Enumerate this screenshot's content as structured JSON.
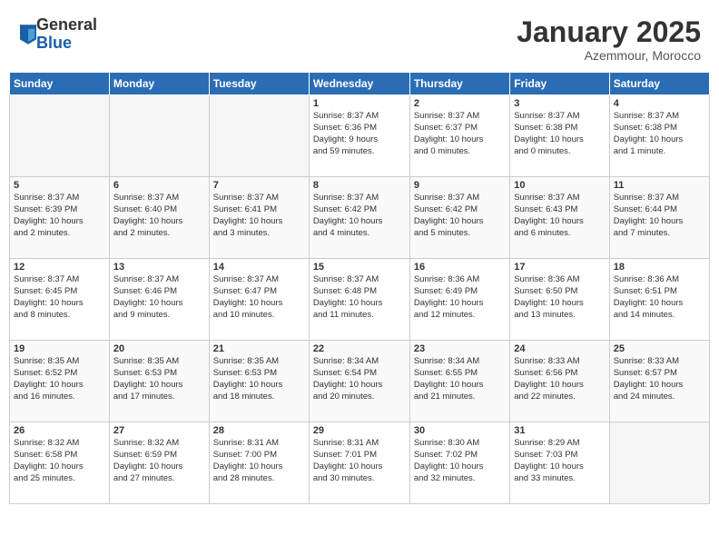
{
  "header": {
    "logo_general": "General",
    "logo_blue": "Blue",
    "month_title": "January 2025",
    "location": "Azemmour, Morocco"
  },
  "weekdays": [
    "Sunday",
    "Monday",
    "Tuesday",
    "Wednesday",
    "Thursday",
    "Friday",
    "Saturday"
  ],
  "weeks": [
    [
      {
        "num": "",
        "info": ""
      },
      {
        "num": "",
        "info": ""
      },
      {
        "num": "",
        "info": ""
      },
      {
        "num": "1",
        "info": "Sunrise: 8:37 AM\nSunset: 6:36 PM\nDaylight: 9 hours\nand 59 minutes."
      },
      {
        "num": "2",
        "info": "Sunrise: 8:37 AM\nSunset: 6:37 PM\nDaylight: 10 hours\nand 0 minutes."
      },
      {
        "num": "3",
        "info": "Sunrise: 8:37 AM\nSunset: 6:38 PM\nDaylight: 10 hours\nand 0 minutes."
      },
      {
        "num": "4",
        "info": "Sunrise: 8:37 AM\nSunset: 6:38 PM\nDaylight: 10 hours\nand 1 minute."
      }
    ],
    [
      {
        "num": "5",
        "info": "Sunrise: 8:37 AM\nSunset: 6:39 PM\nDaylight: 10 hours\nand 2 minutes."
      },
      {
        "num": "6",
        "info": "Sunrise: 8:37 AM\nSunset: 6:40 PM\nDaylight: 10 hours\nand 2 minutes."
      },
      {
        "num": "7",
        "info": "Sunrise: 8:37 AM\nSunset: 6:41 PM\nDaylight: 10 hours\nand 3 minutes."
      },
      {
        "num": "8",
        "info": "Sunrise: 8:37 AM\nSunset: 6:42 PM\nDaylight: 10 hours\nand 4 minutes."
      },
      {
        "num": "9",
        "info": "Sunrise: 8:37 AM\nSunset: 6:42 PM\nDaylight: 10 hours\nand 5 minutes."
      },
      {
        "num": "10",
        "info": "Sunrise: 8:37 AM\nSunset: 6:43 PM\nDaylight: 10 hours\nand 6 minutes."
      },
      {
        "num": "11",
        "info": "Sunrise: 8:37 AM\nSunset: 6:44 PM\nDaylight: 10 hours\nand 7 minutes."
      }
    ],
    [
      {
        "num": "12",
        "info": "Sunrise: 8:37 AM\nSunset: 6:45 PM\nDaylight: 10 hours\nand 8 minutes."
      },
      {
        "num": "13",
        "info": "Sunrise: 8:37 AM\nSunset: 6:46 PM\nDaylight: 10 hours\nand 9 minutes."
      },
      {
        "num": "14",
        "info": "Sunrise: 8:37 AM\nSunset: 6:47 PM\nDaylight: 10 hours\nand 10 minutes."
      },
      {
        "num": "15",
        "info": "Sunrise: 8:37 AM\nSunset: 6:48 PM\nDaylight: 10 hours\nand 11 minutes."
      },
      {
        "num": "16",
        "info": "Sunrise: 8:36 AM\nSunset: 6:49 PM\nDaylight: 10 hours\nand 12 minutes."
      },
      {
        "num": "17",
        "info": "Sunrise: 8:36 AM\nSunset: 6:50 PM\nDaylight: 10 hours\nand 13 minutes."
      },
      {
        "num": "18",
        "info": "Sunrise: 8:36 AM\nSunset: 6:51 PM\nDaylight: 10 hours\nand 14 minutes."
      }
    ],
    [
      {
        "num": "19",
        "info": "Sunrise: 8:35 AM\nSunset: 6:52 PM\nDaylight: 10 hours\nand 16 minutes."
      },
      {
        "num": "20",
        "info": "Sunrise: 8:35 AM\nSunset: 6:53 PM\nDaylight: 10 hours\nand 17 minutes."
      },
      {
        "num": "21",
        "info": "Sunrise: 8:35 AM\nSunset: 6:53 PM\nDaylight: 10 hours\nand 18 minutes."
      },
      {
        "num": "22",
        "info": "Sunrise: 8:34 AM\nSunset: 6:54 PM\nDaylight: 10 hours\nand 20 minutes."
      },
      {
        "num": "23",
        "info": "Sunrise: 8:34 AM\nSunset: 6:55 PM\nDaylight: 10 hours\nand 21 minutes."
      },
      {
        "num": "24",
        "info": "Sunrise: 8:33 AM\nSunset: 6:56 PM\nDaylight: 10 hours\nand 22 minutes."
      },
      {
        "num": "25",
        "info": "Sunrise: 8:33 AM\nSunset: 6:57 PM\nDaylight: 10 hours\nand 24 minutes."
      }
    ],
    [
      {
        "num": "26",
        "info": "Sunrise: 8:32 AM\nSunset: 6:58 PM\nDaylight: 10 hours\nand 25 minutes."
      },
      {
        "num": "27",
        "info": "Sunrise: 8:32 AM\nSunset: 6:59 PM\nDaylight: 10 hours\nand 27 minutes."
      },
      {
        "num": "28",
        "info": "Sunrise: 8:31 AM\nSunset: 7:00 PM\nDaylight: 10 hours\nand 28 minutes."
      },
      {
        "num": "29",
        "info": "Sunrise: 8:31 AM\nSunset: 7:01 PM\nDaylight: 10 hours\nand 30 minutes."
      },
      {
        "num": "30",
        "info": "Sunrise: 8:30 AM\nSunset: 7:02 PM\nDaylight: 10 hours\nand 32 minutes."
      },
      {
        "num": "31",
        "info": "Sunrise: 8:29 AM\nSunset: 7:03 PM\nDaylight: 10 hours\nand 33 minutes."
      },
      {
        "num": "",
        "info": ""
      }
    ]
  ]
}
